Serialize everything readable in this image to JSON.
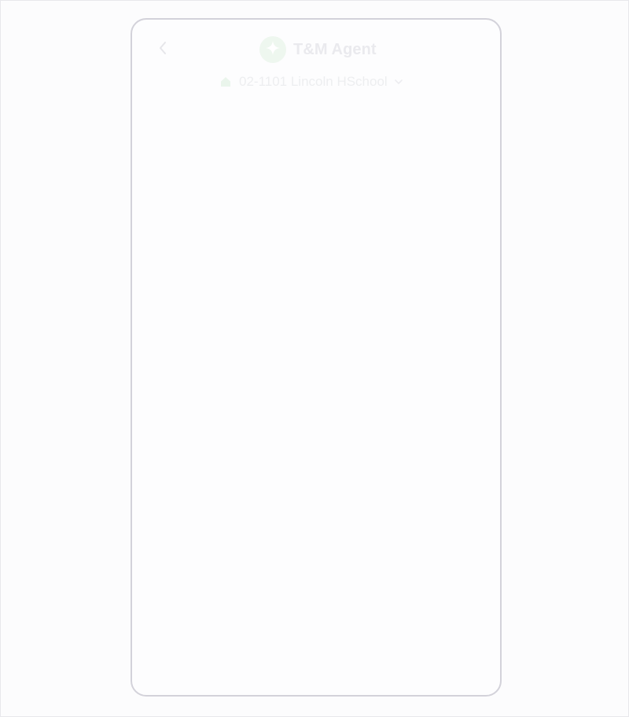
{
  "header": {
    "title": "T&M Agent",
    "back_icon": "chevron-left-icon",
    "logo_icon": "sparkle-icon"
  },
  "project": {
    "name": "02-1101 Lincoln HSchool",
    "icon": "home-icon",
    "dropdown_icon": "chevron-down-icon"
  },
  "colors": {
    "accent_green_faded": "#eaf5ec",
    "text_faded": "#eaeaee",
    "phone_border": "#d3d2da"
  }
}
